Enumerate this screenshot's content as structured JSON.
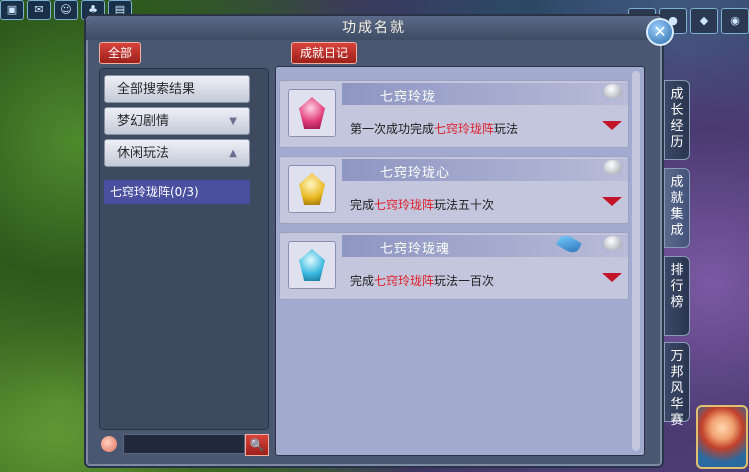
{
  "panel": {
    "title": "功成名就",
    "close_label": "✕"
  },
  "top_buttons": {
    "all": "全部",
    "diary": "成就日记"
  },
  "categories": [
    {
      "label": "全部搜索结果",
      "arrow": ""
    },
    {
      "label": "梦幻剧情",
      "arrow": "▼"
    },
    {
      "label": "休闲玩法",
      "arrow": "▲"
    }
  ],
  "selected_category": "七窍玲珑阵(0/3)",
  "search": {
    "value": "",
    "placeholder": "",
    "button_label": "🔍"
  },
  "entries": [
    {
      "title": "七窍玲珑",
      "desc_pre": "第一次成功完成",
      "desc_hl": "七窍玲珑阵",
      "desc_post": "玩法",
      "gem": "red"
    },
    {
      "title": "七窍玲珑心",
      "desc_pre": "完成",
      "desc_hl": "七窍玲珑阵",
      "desc_post": "玩法五十次",
      "gem": "gold"
    },
    {
      "title": "七窍玲珑魂",
      "desc_pre": "完成",
      "desc_hl": "七窍玲珑阵",
      "desc_post": "玩法一百次",
      "gem": "cyan"
    }
  ],
  "side_tabs": [
    "成长经历",
    "成就集成",
    "排行榜",
    "万邦风华赛"
  ],
  "colors": {
    "highlight": "#e0202a",
    "accent_red": "#d8443c",
    "selected_bg": "#4a4fa0"
  }
}
